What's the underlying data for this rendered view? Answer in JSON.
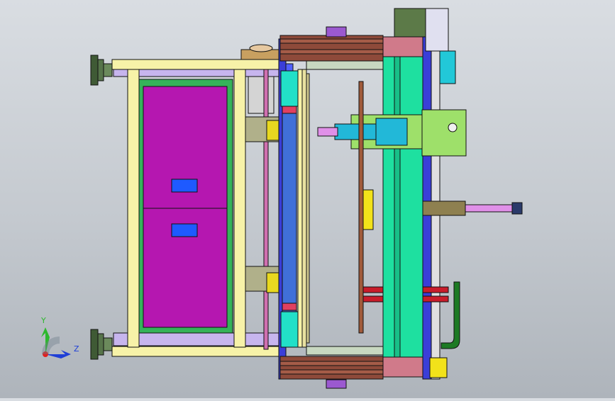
{
  "viewport": {
    "background_top": "#d9dde2",
    "background_bottom": "#aeb4bb"
  },
  "triad": {
    "y_label": "Y",
    "z_label": "Z",
    "y_color": "#2db82d",
    "z_color": "#1f3fd6",
    "x_color": "#e02020"
  },
  "colors": {
    "frame_yellow": "#f7f2a8",
    "frame_lilac": "#c7b5ee",
    "panel_green": "#35b35a",
    "panel_magenta": "#b517b0",
    "label_blue": "#1e5aff",
    "rail_blue": "#3a3ed8",
    "cylinder_cyan": "#22e0c8",
    "slab_mint": "#1ee0a0",
    "block_brown": "#8e4a3a",
    "slider_green": "#9ee06a",
    "plate_cyan": "#22b8d8",
    "cylinder_pink": "#e090e8",
    "pad_dark": "#3f5a35",
    "bracket_yellow": "#f2e21a",
    "bar_red": "#c81c2a",
    "arm_green": "#1d7a24",
    "motor_olive": "#5c7a48",
    "cover_rose": "#d07a8a"
  }
}
